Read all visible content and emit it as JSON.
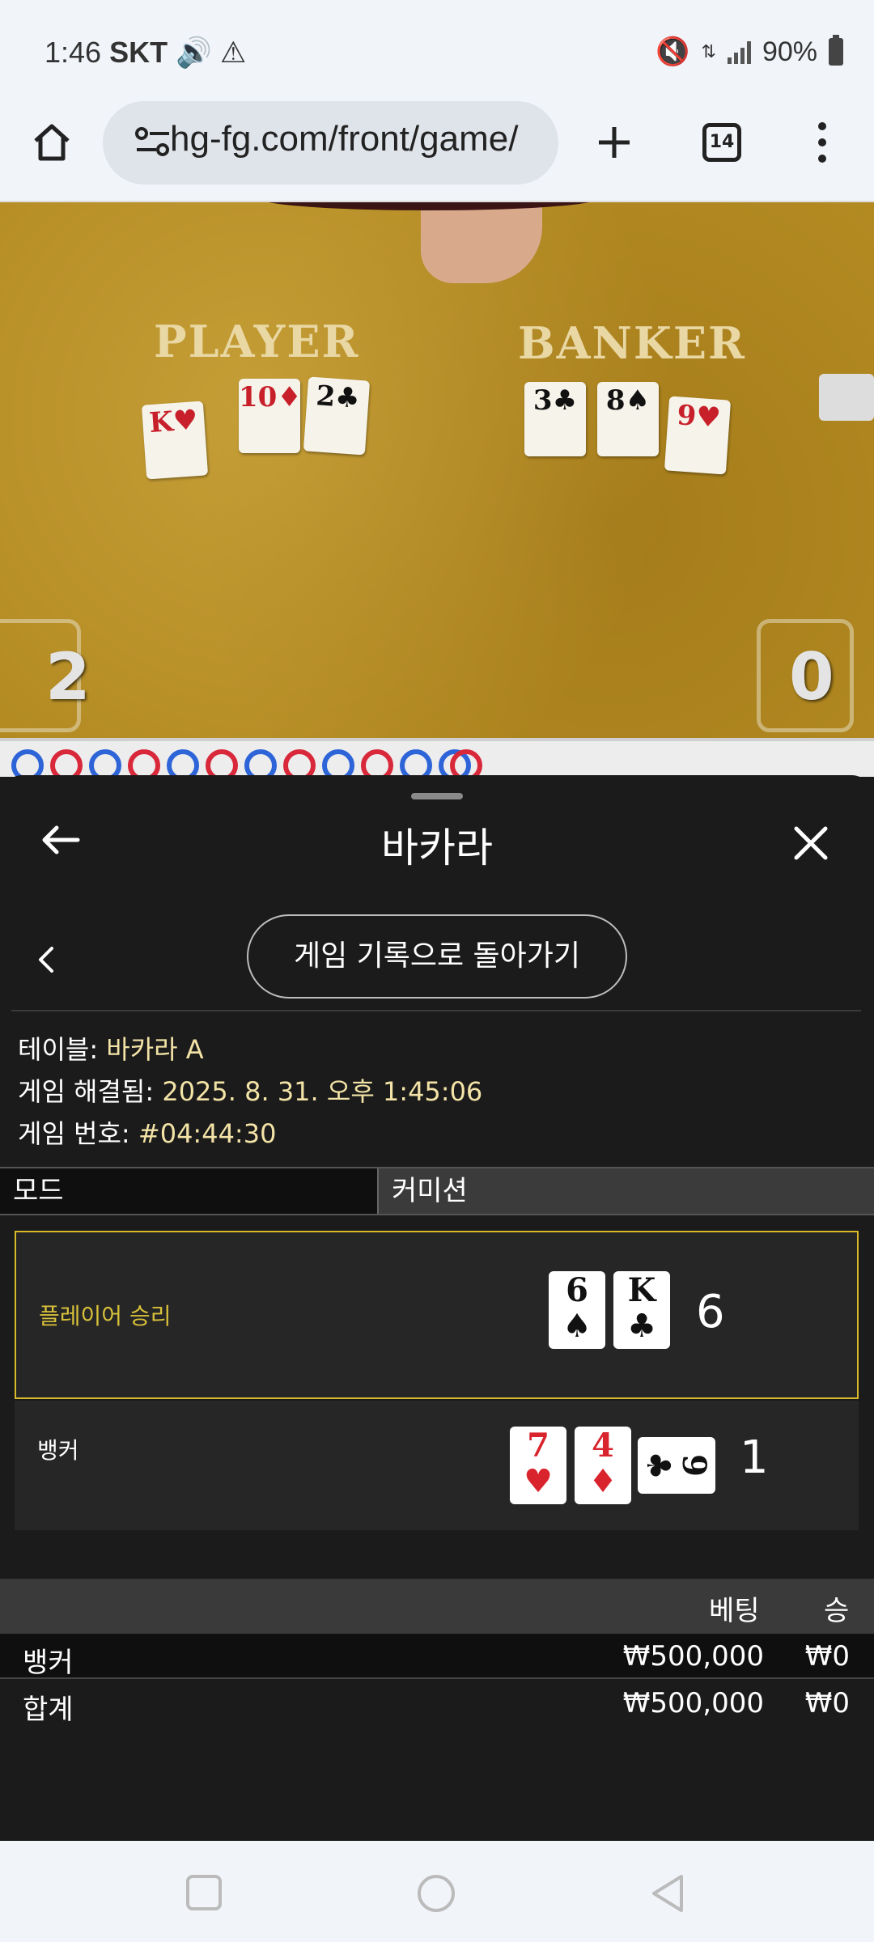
{
  "status_bar": {
    "time": "1:46",
    "carrier": "SKT",
    "battery": "90%"
  },
  "browser": {
    "url": "hg-fg.com/front/game/",
    "tab_count": "14"
  },
  "video": {
    "player_label": "PLAYER",
    "banker_label": "BANKER",
    "player_score": "2",
    "banker_score": "0",
    "player_cards": [
      {
        "rank": "K",
        "suit": "♥",
        "color": "#c8202b"
      },
      {
        "rank": "10",
        "suit": "♦",
        "color": "#c8202b"
      },
      {
        "rank": "2",
        "suit": "♣",
        "color": "#111111"
      }
    ],
    "banker_cards": [
      {
        "rank": "3",
        "suit": "♣",
        "color": "#111111"
      },
      {
        "rank": "8",
        "suit": "♠",
        "color": "#111111"
      },
      {
        "rank": "9",
        "suit": "♥",
        "color": "#c8202b"
      }
    ]
  },
  "sheet": {
    "title": "바카라",
    "history_button": "게임 기록으로 돌아가기",
    "table_label": "테이블: ",
    "table_value": "바카라 A",
    "resolved_label": "게임 해결됨: ",
    "resolved_value": "2025. 8. 31. 오후 1:45:06",
    "game_no_label": "게임 번호: ",
    "game_no_value": "#04:44:30",
    "tab_mode": "모드",
    "tab_commission": "커미션",
    "player_result": {
      "label": "플레이어 승리",
      "score": "6",
      "cards": [
        {
          "rank": "6",
          "suit": "♠",
          "color": "black"
        },
        {
          "rank": "K",
          "suit": "♣",
          "color": "black"
        }
      ]
    },
    "banker_result": {
      "label": "뱅커",
      "score": "1",
      "cards": [
        {
          "rank": "7",
          "suit": "♥",
          "color": "red"
        },
        {
          "rank": "4",
          "suit": "♦",
          "color": "red"
        },
        {
          "rank": "9",
          "suit": "♣",
          "color": "black",
          "sideways": true
        }
      ]
    },
    "bet_table": {
      "header_bet": "베팅",
      "header_win": "승",
      "rows": [
        {
          "name": "뱅커",
          "bet": "₩500,000",
          "win": "₩0"
        },
        {
          "name": "합계",
          "bet": "₩500,000",
          "win": "₩0"
        }
      ]
    }
  },
  "colors": {
    "accent_gold": "#d8b92a",
    "felt": "#b38a22"
  }
}
